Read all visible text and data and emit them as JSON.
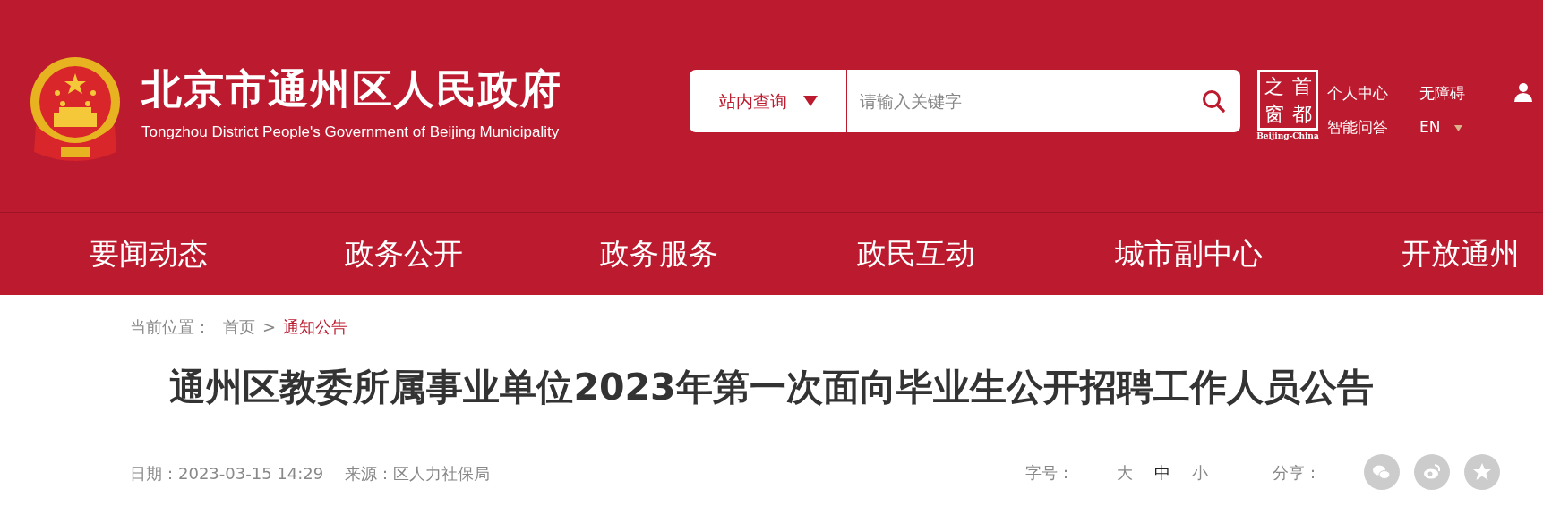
{
  "header": {
    "site_title": "北京市通州区人民政府",
    "site_subtitle": "Tongzhou District People's Government of Beijing Municipality",
    "search": {
      "scope": "站内查询",
      "placeholder": "请输入关键字"
    },
    "portal_logo": {
      "chars": [
        "之",
        "首",
        "窗",
        "都"
      ],
      "caption": "Beijing-China"
    },
    "links": [
      {
        "label": "个人中心"
      },
      {
        "label": "智能问答"
      },
      {
        "label": "无障碍"
      },
      {
        "label": "EN",
        "dropdown": true
      }
    ]
  },
  "nav": [
    {
      "label": "要闻动态"
    },
    {
      "label": "政务公开"
    },
    {
      "label": "政务服务"
    },
    {
      "label": "政民互动"
    },
    {
      "label": "城市副中心"
    },
    {
      "label": "开放通州"
    }
  ],
  "breadcrumb": {
    "prefix": "当前位置：",
    "items": [
      {
        "label": "首页",
        "current": false
      },
      {
        "label": "通知公告",
        "current": true
      }
    ],
    "separator": ">"
  },
  "article": {
    "title": "通州区教委所属事业单位2023年第一次面向毕业生公开招聘工作人员公告",
    "date": "日期：2023-03-15 14:29",
    "source": "来源：区人力社保局",
    "font_size_label": "字号：",
    "font_sizes": [
      {
        "label": "大",
        "selected": false
      },
      {
        "label": "中",
        "selected": true
      },
      {
        "label": "小",
        "selected": false
      }
    ],
    "share_label": "分享：",
    "share": [
      {
        "kind": "wechat"
      },
      {
        "kind": "weibo"
      },
      {
        "kind": "qzone"
      }
    ]
  }
}
